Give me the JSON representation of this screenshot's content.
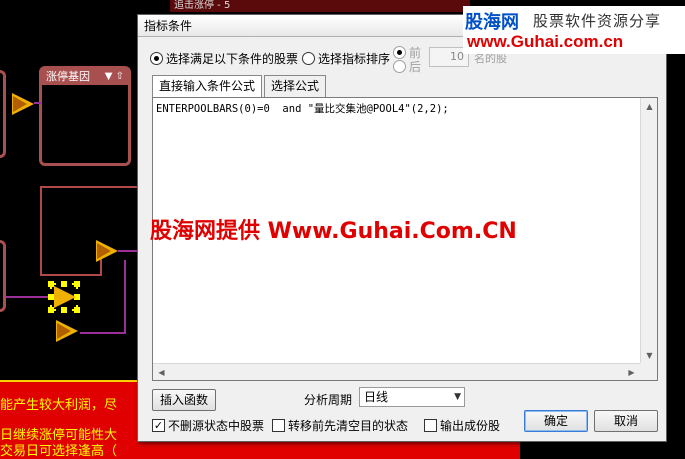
{
  "background": {
    "top_strip": "追击涨停 - 5",
    "node_title": "涨停基因",
    "node_controls": "▼ ⇧",
    "bottom_lines": [
      "能产生较大利润，尽",
      "日继续涨停可能性大",
      "交易日可选择逢高（"
    ]
  },
  "watermark": {
    "brand": "股海网",
    "slogan": "股票软件资源分享",
    "url": "www.Guhai.com.cn",
    "center": "股海网提供 Www.Guhai.Com.CN"
  },
  "dialog": {
    "title": "指标条件",
    "radio_condition": "选择满足以下条件的股票",
    "radio_sort": "选择指标排序",
    "radio_front": "前",
    "radio_back": "后",
    "count_value": "10",
    "count_suffix": "名的股",
    "tabs": [
      {
        "label": "直接输入条件公式"
      },
      {
        "label": "选择公式"
      }
    ],
    "formula": "ENTERPOOLBARS(0)=0  and \"量比交集池@POOL4\"(2,2);",
    "insert_function": "插入函数",
    "period_label": "分析周期",
    "period_value": "日线",
    "chk_no_delete": "不删源状态中股票",
    "chk_clear_empty": "转移前先清空目的状态",
    "chk_output": "输出成份股",
    "ok": "确定",
    "cancel": "取消"
  }
}
